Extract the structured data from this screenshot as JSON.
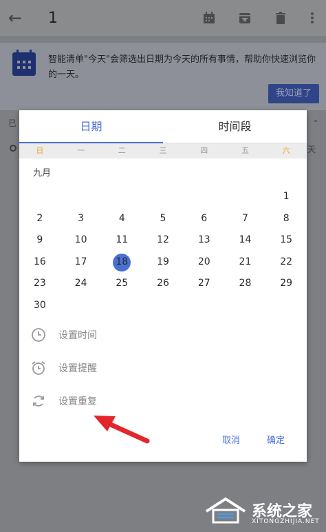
{
  "appbar": {
    "title": "1",
    "back_icon": "arrow-left-icon",
    "actions": [
      "calendar-icon",
      "archive-icon",
      "trash-icon",
      "more-vert-icon"
    ]
  },
  "banner": {
    "text": "智能清单\"今天\"会筛选出日期为今天的所有事情，帮助你快速浏览你的一天。",
    "button": "我知道了"
  },
  "background": {
    "row_label": "已",
    "right_text": "天"
  },
  "dialog": {
    "tabs": [
      {
        "label": "日期",
        "active": true
      },
      {
        "label": "时间段",
        "active": false
      }
    ],
    "weekdays": [
      "日",
      "一",
      "二",
      "三",
      "四",
      "五",
      "六"
    ],
    "month": "九月",
    "weeks": [
      [
        "",
        "",
        "",
        "",
        "",
        "",
        "1"
      ],
      [
        "2",
        "3",
        "4",
        "5",
        "6",
        "7",
        "8"
      ],
      [
        "9",
        "10",
        "11",
        "12",
        "13",
        "14",
        "15"
      ],
      [
        "16",
        "17",
        "18",
        "19",
        "20",
        "21",
        "22"
      ],
      [
        "23",
        "24",
        "25",
        "26",
        "27",
        "28",
        "29"
      ],
      [
        "30",
        "",
        "",
        "",
        "",
        "",
        ""
      ]
    ],
    "selected_day": "18",
    "options": [
      {
        "label": "设置时间",
        "icon": "clock-icon"
      },
      {
        "label": "设置提醒",
        "icon": "alarm-icon"
      },
      {
        "label": "设置重复",
        "icon": "repeat-icon"
      }
    ],
    "cancel": "取消",
    "confirm": "确定"
  },
  "watermark": {
    "text": "系统之家",
    "sub": "XITONGZHIJIA.NET"
  },
  "colors": {
    "accent": "#4a6fd4",
    "weekend": "#e7a62f",
    "arrow": "#e3262b"
  }
}
